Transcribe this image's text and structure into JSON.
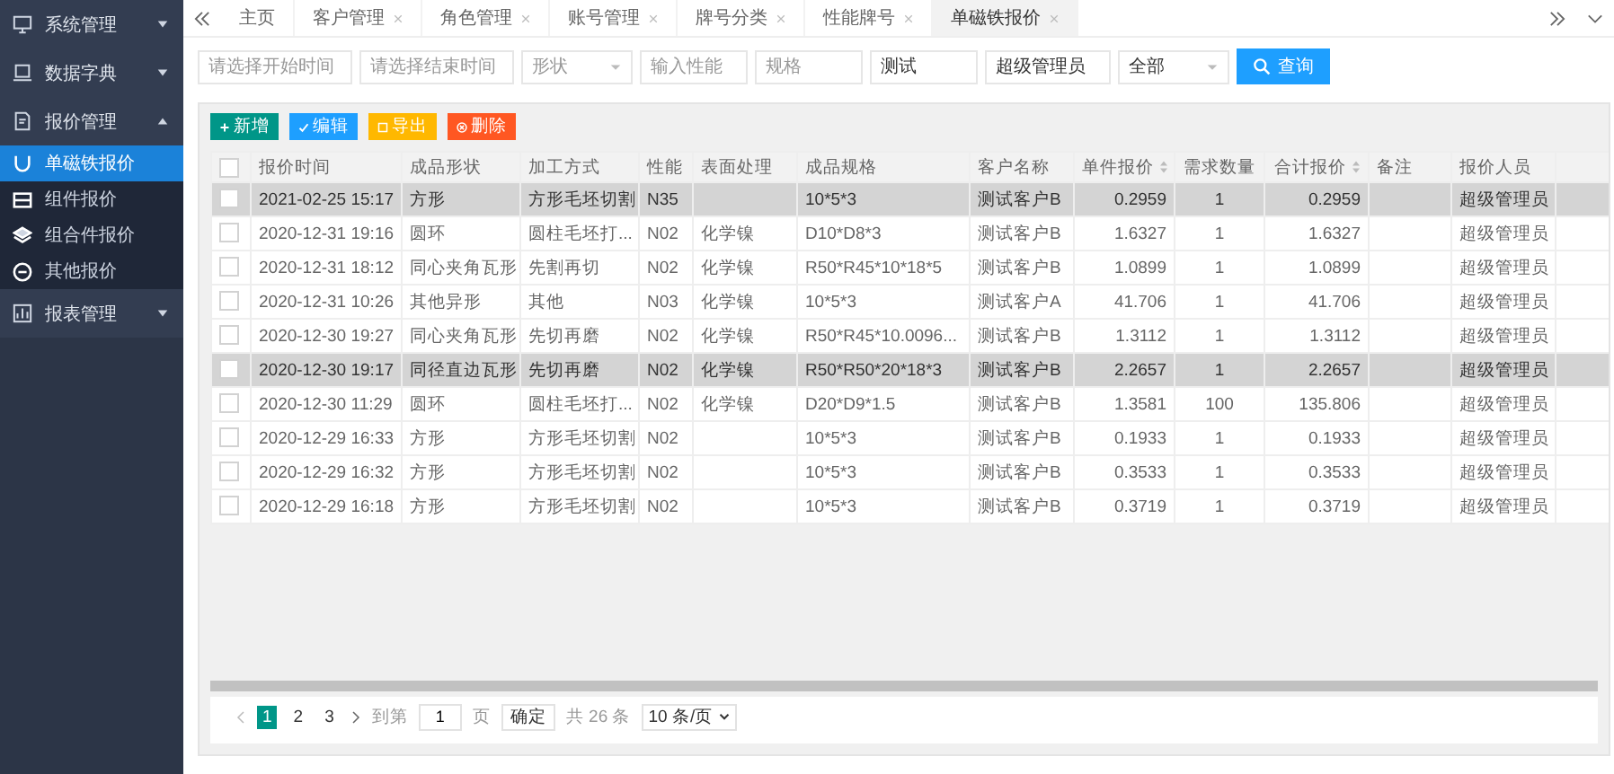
{
  "sidebar": {
    "items": [
      {
        "label": "系统管理",
        "expanded": false
      },
      {
        "label": "数据字典",
        "expanded": false
      },
      {
        "label": "报价管理",
        "expanded": true,
        "children": [
          {
            "label": "单磁铁报价",
            "selected": true
          },
          {
            "label": "组件报价",
            "selected": false
          },
          {
            "label": "组合件报价",
            "selected": false
          },
          {
            "label": "其他报价",
            "selected": false
          }
        ]
      },
      {
        "label": "报表管理",
        "expanded": false
      }
    ]
  },
  "tabs": [
    {
      "label": "主页",
      "closable": false,
      "selected": false
    },
    {
      "label": "客户管理",
      "closable": true,
      "selected": false
    },
    {
      "label": "角色管理",
      "closable": true,
      "selected": false
    },
    {
      "label": "账号管理",
      "closable": true,
      "selected": false
    },
    {
      "label": "牌号分类",
      "closable": true,
      "selected": false
    },
    {
      "label": "性能牌号",
      "closable": true,
      "selected": false
    },
    {
      "label": "单磁铁报价",
      "closable": true,
      "selected": true
    }
  ],
  "filters": [
    {
      "kind": "input",
      "placeholder": "请选择开始时间"
    },
    {
      "kind": "input",
      "placeholder": "请选择结束时间"
    },
    {
      "kind": "select",
      "placeholder": "形状"
    },
    {
      "kind": "input",
      "placeholder": "输入性能"
    },
    {
      "kind": "input",
      "placeholder": "规格"
    },
    {
      "kind": "input",
      "value": "测试"
    },
    {
      "kind": "input",
      "value": "超级管理员"
    },
    {
      "kind": "select",
      "value": "全部"
    }
  ],
  "search_button": "查询",
  "toolbar": [
    {
      "kind": "add",
      "label": "新增",
      "color": "#009688"
    },
    {
      "kind": "edit",
      "label": "编辑",
      "color": "#1e9fff"
    },
    {
      "kind": "export",
      "label": "导出",
      "color": "#ffb800"
    },
    {
      "kind": "delete",
      "label": "删除",
      "color": "#ff5722"
    }
  ],
  "table": {
    "all_checked": false,
    "columns": [
      {
        "label": "报价时间",
        "kind": "text",
        "sortable": false
      },
      {
        "label": "成品形状",
        "kind": "text",
        "sortable": false
      },
      {
        "label": "加工方式",
        "kind": "text",
        "sortable": false
      },
      {
        "label": "性能",
        "kind": "text",
        "sortable": false
      },
      {
        "label": "表面处理",
        "kind": "text",
        "sortable": false
      },
      {
        "label": "成品规格",
        "kind": "text",
        "sortable": false
      },
      {
        "label": "客户名称",
        "kind": "text",
        "sortable": false
      },
      {
        "label": "单件报价",
        "kind": "number",
        "sortable": true
      },
      {
        "label": "需求数量",
        "kind": "count",
        "sortable": false
      },
      {
        "label": "合计报价",
        "kind": "number",
        "sortable": true
      },
      {
        "label": "备注",
        "kind": "text",
        "sortable": false
      },
      {
        "label": "报价人员",
        "kind": "text",
        "sortable": false
      }
    ],
    "rows": [
      {
        "selected": true,
        "cells": [
          "2021-02-25 15:17",
          "方形",
          "方形毛坯切割",
          "N35",
          "",
          "10*5*3",
          "测试客户B",
          "0.2959",
          "1",
          "0.2959",
          "",
          "超级管理员"
        ]
      },
      {
        "selected": false,
        "cells": [
          "2020-12-31 19:16",
          "圆环",
          "圆柱毛坯打...",
          "N02",
          "化学镍",
          "D10*D8*3",
          "测试客户B",
          "1.6327",
          "1",
          "1.6327",
          "",
          "超级管理员"
        ]
      },
      {
        "selected": false,
        "cells": [
          "2020-12-31 18:12",
          "同心夹角瓦形",
          "先割再切",
          "N02",
          "化学镍",
          "R50*R45*10*18*5",
          "测试客户B",
          "1.0899",
          "1",
          "1.0899",
          "",
          "超级管理员"
        ]
      },
      {
        "selected": false,
        "cells": [
          "2020-12-31 10:26",
          "其他异形",
          "其他",
          "N03",
          "化学镍",
          "10*5*3",
          "测试客户A",
          "41.706",
          "1",
          "41.706",
          "",
          "超级管理员"
        ]
      },
      {
        "selected": false,
        "cells": [
          "2020-12-30 19:27",
          "同心夹角瓦形",
          "先切再磨",
          "N02",
          "化学镍",
          "R50*R45*10.0096...",
          "测试客户B",
          "1.3112",
          "1",
          "1.3112",
          "",
          "超级管理员"
        ]
      },
      {
        "selected": true,
        "cells": [
          "2020-12-30 19:17",
          "同径直边瓦形",
          "先切再磨",
          "N02",
          "化学镍",
          "R50*R50*20*18*3",
          "测试客户B",
          "2.2657",
          "1",
          "2.2657",
          "",
          "超级管理员"
        ]
      },
      {
        "selected": false,
        "cells": [
          "2020-12-30 11:29",
          "圆环",
          "圆柱毛坯打...",
          "N02",
          "化学镍",
          "D20*D9*1.5",
          "测试客户B",
          "1.3581",
          "100",
          "135.806",
          "",
          "超级管理员"
        ]
      },
      {
        "selected": false,
        "cells": [
          "2020-12-29 16:33",
          "方形",
          "方形毛坯切割",
          "N02",
          "",
          "10*5*3",
          "测试客户B",
          "0.1933",
          "1",
          "0.1933",
          "",
          "超级管理员"
        ]
      },
      {
        "selected": false,
        "cells": [
          "2020-12-29 16:32",
          "方形",
          "方形毛坯切割",
          "N02",
          "",
          "10*5*3",
          "测试客户B",
          "0.3533",
          "1",
          "0.3533",
          "",
          "超级管理员"
        ]
      },
      {
        "selected": false,
        "cells": [
          "2020-12-29 16:18",
          "方形",
          "方形毛坯切割",
          "N02",
          "",
          "10*5*3",
          "测试客户B",
          "0.3719",
          "1",
          "0.3719",
          "",
          "超级管理员"
        ]
      }
    ]
  },
  "pagination": {
    "pages": [
      {
        "label": "1",
        "selected": true
      },
      {
        "label": "2",
        "selected": false
      },
      {
        "label": "3",
        "selected": false
      }
    ],
    "goto_label": "到第",
    "goto_value": "1",
    "page_unit": "页",
    "confirm": "确定",
    "total": "共 26 条",
    "page_size": "10 条/页"
  }
}
